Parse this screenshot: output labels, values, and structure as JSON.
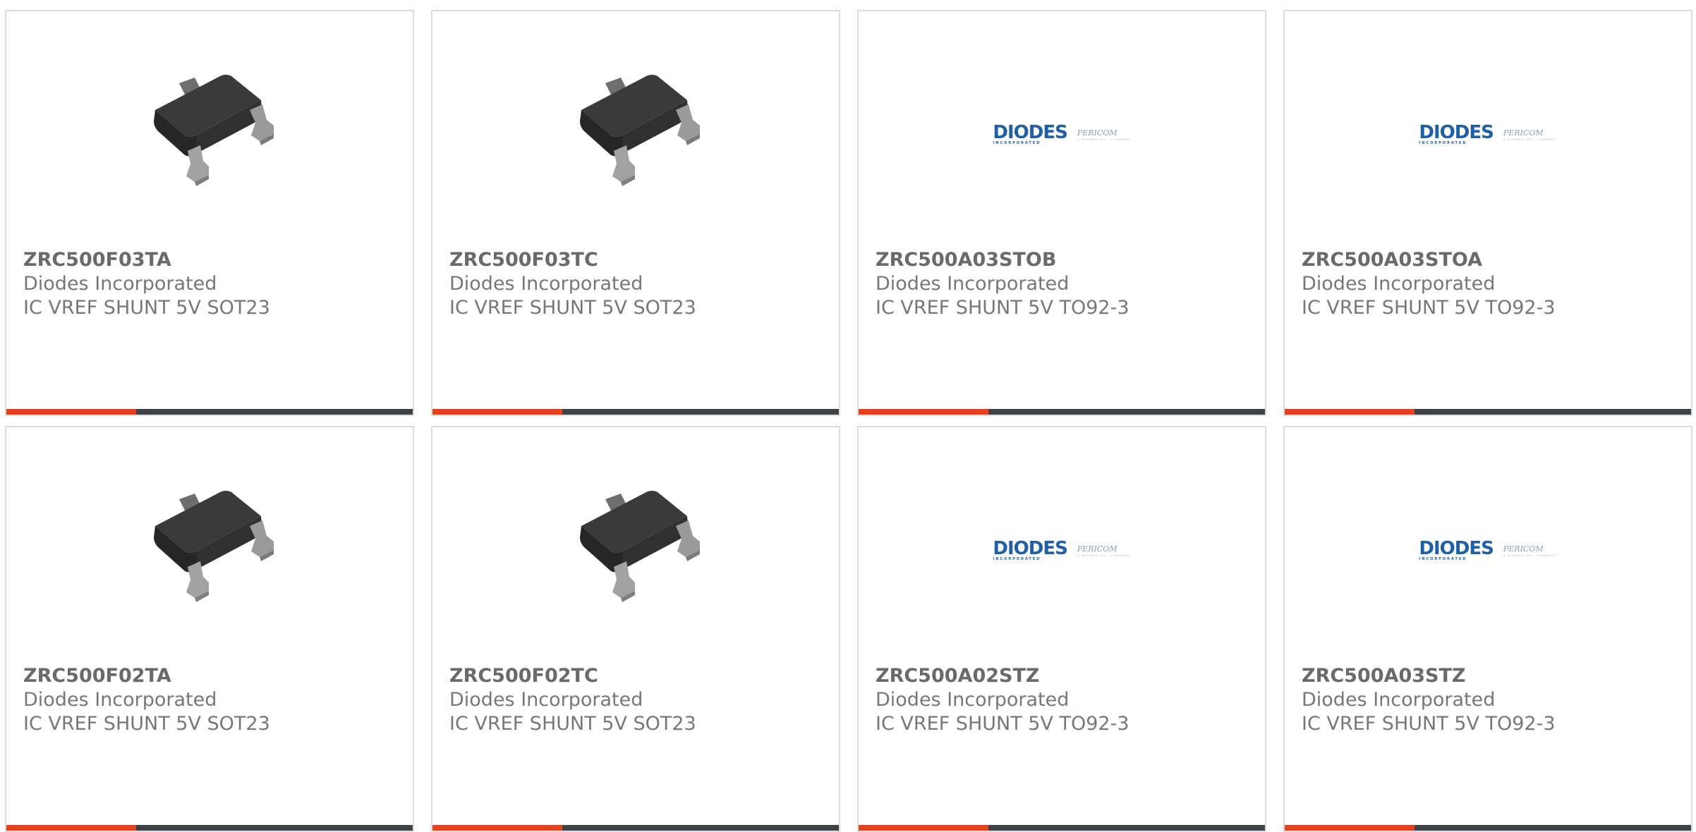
{
  "colors": {
    "accent": "#e8401c",
    "bar": "#3f4244",
    "border": "#dcdcdc",
    "text": "#777777",
    "logo_blue": "#1f5fa6"
  },
  "products": [
    {
      "part": "ZRC500F03TA",
      "manufacturer": "Diodes Incorporated",
      "description": "IC VREF SHUNT 5V SOT23",
      "image": "sot23-chip-icon"
    },
    {
      "part": "ZRC500F03TC",
      "manufacturer": "Diodes Incorporated",
      "description": "IC VREF SHUNT 5V SOT23",
      "image": "sot23-chip-icon"
    },
    {
      "part": "ZRC500A03STOB",
      "manufacturer": "Diodes Incorporated",
      "description": "IC VREF SHUNT 5V TO92-3",
      "image": "diodes-logo"
    },
    {
      "part": "ZRC500A03STOA",
      "manufacturer": "Diodes Incorporated",
      "description": "IC VREF SHUNT 5V TO92-3",
      "image": "diodes-logo"
    },
    {
      "part": "ZRC500F02TA",
      "manufacturer": "Diodes Incorporated",
      "description": "IC VREF SHUNT 5V SOT23",
      "image": "sot23-chip-icon"
    },
    {
      "part": "ZRC500F02TC",
      "manufacturer": "Diodes Incorporated",
      "description": "IC VREF SHUNT 5V SOT23",
      "image": "sot23-chip-icon"
    },
    {
      "part": "ZRC500A02STZ",
      "manufacturer": "Diodes Incorporated",
      "description": "IC VREF SHUNT 5V TO92-3",
      "image": "diodes-logo"
    },
    {
      "part": "ZRC500A03STZ",
      "manufacturer": "Diodes Incorporated",
      "description": "IC VREF SHUNT 5V TO92-3",
      "image": "diodes-logo"
    }
  ],
  "logo": {
    "brand": "DIODES",
    "brand_sub": "INCORPORATED",
    "partner": "PERICOM",
    "partner_sub": "A DIODES INC. COMPANY"
  }
}
